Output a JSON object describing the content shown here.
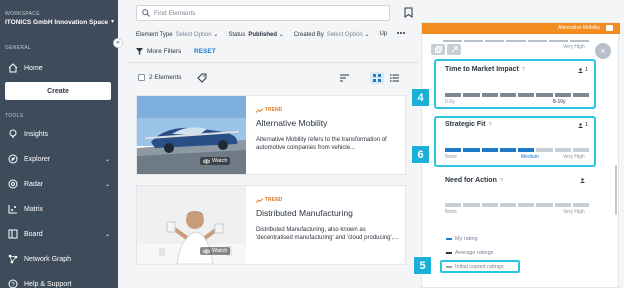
{
  "sidebar": {
    "workspace_label": "WORKSPACE",
    "workspace_name": "ITONICS GmbH Innovation Space",
    "general_label": "GENERAL",
    "home": "Home",
    "create": "Create",
    "tools_label": "TOOLS",
    "items": [
      {
        "label": "Insights",
        "icon": "lightbulb-icon"
      },
      {
        "label": "Explorer",
        "icon": "compass-icon"
      },
      {
        "label": "Radar",
        "icon": "radar-icon"
      },
      {
        "label": "Matrix",
        "icon": "matrix-icon"
      },
      {
        "label": "Board",
        "icon": "board-icon"
      },
      {
        "label": "Network Graph",
        "icon": "network-icon"
      },
      {
        "label": "Help & Support",
        "icon": "help-icon"
      }
    ]
  },
  "search": {
    "placeholder": "Find Elements"
  },
  "filters": {
    "element_type_label": "Element Type",
    "element_type_value": "Select Option",
    "status_label": "Status",
    "status_value": "Published",
    "created_by_label": "Created By",
    "created_by_value": "Select Option",
    "cut_label": "Up",
    "more_filters": "More Filters",
    "reset": "RESET"
  },
  "list": {
    "count": "2 Elements",
    "cards": [
      {
        "type": "TREND",
        "title": "Alternative Mobility",
        "desc": "Alternative Mobility refers to the transformation of automotive companies from vehicle...",
        "watch": "Watch"
      },
      {
        "type": "TREND",
        "title": "Distributed Manufacturing",
        "desc": "Distributed Manufacturing, also known as 'decentralised manufacturing' and 'cloud producing',...",
        "watch": "Watch"
      }
    ]
  },
  "panel": {
    "header_label": "Alternative Mobility",
    "very_high_top": "Very High",
    "ratings": [
      {
        "title": "Time to Market Impact",
        "count": "1",
        "scale_left": "0-2y",
        "scale_right": "8-10y",
        "selected_index": 7,
        "segments": 8
      },
      {
        "title": "Strategic Fit",
        "count": "1",
        "scale_left": "None",
        "scale_mid": "Medium",
        "scale_right": "Very High",
        "selected_index": 4,
        "segments": 8
      },
      {
        "title": "Need for Action",
        "count": "",
        "scale_left": "None",
        "scale_right": "Very High",
        "segments": 8
      }
    ],
    "legend": {
      "my_rating": "My rating",
      "average": "Average ratings",
      "copied": "Initial copied ratings"
    }
  },
  "badges": {
    "b4": "4",
    "b5": "5",
    "b6": "6"
  },
  "colors": {
    "sidebar": "#3e4b5a",
    "accent_orange": "#f28c1e",
    "rating_blue": "#1f7ac6",
    "highlight_cyan": "#29c4e0"
  }
}
